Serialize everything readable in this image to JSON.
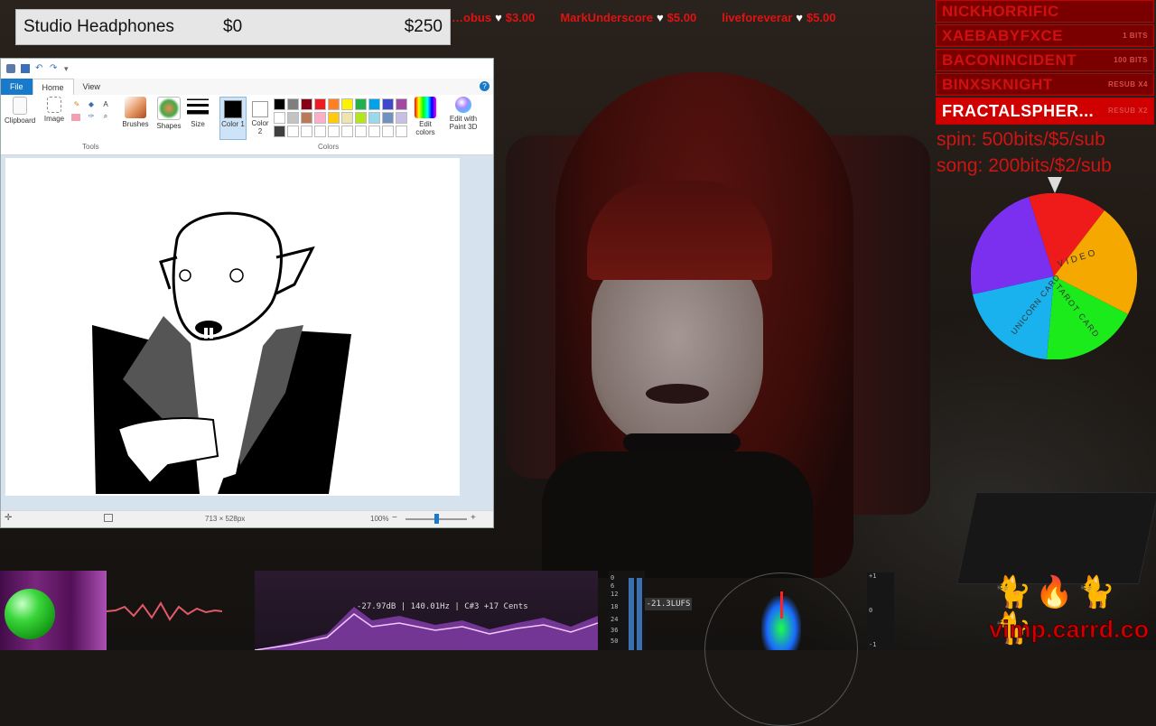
{
  "ticker": [
    {
      "name": "…obus",
      "amount": "$3.00"
    },
    {
      "name": "MarkUnderscore",
      "amount": "$5.00"
    },
    {
      "name": "liveforeverar",
      "amount": "$5.00"
    }
  ],
  "goal": {
    "name": "Studio Headphones",
    "start": "$0",
    "end": "$250",
    "progress": 0
  },
  "paint": {
    "tabs": {
      "file": "File",
      "home": "Home",
      "view": "View"
    },
    "help": "?",
    "ribbon": {
      "clipboard": "Clipboard",
      "image": "Image",
      "tools": "Tools",
      "brushes": "Brushes",
      "shapes": "Shapes",
      "size": "Size",
      "color1": "Color 1",
      "color2": "Color 2",
      "colors": "Colors",
      "edit_colors": "Edit colors",
      "edit_paint3d": "Edit with Paint 3D"
    },
    "palette": [
      "#000000",
      "#7f7f7f",
      "#880015",
      "#ed1c24",
      "#ff7f27",
      "#fff200",
      "#22b14c",
      "#00a2e8",
      "#3f48cc",
      "#a349a4",
      "#ffffff",
      "#c3c3c3",
      "#b97a57",
      "#ffaec9",
      "#ffc90e",
      "#efe4b0",
      "#b5e61d",
      "#99d9ea",
      "#7092be",
      "#c8bfe7",
      "#404040",
      "#ffffff",
      "#ffffff",
      "#ffffff",
      "#ffffff",
      "#ffffff",
      "#ffffff",
      "#ffffff",
      "#ffffff",
      "#ffffff"
    ],
    "status": {
      "dimensions": "713 × 528px",
      "zoom": "100%",
      "zoom_out": "−",
      "zoom_in": "+"
    }
  },
  "recent_events": [
    {
      "name": "NICKHORRIFIC",
      "tag": ""
    },
    {
      "name": "XAEBABYFXCE",
      "tag": "1 BITS"
    },
    {
      "name": "BACONINCIDENT",
      "tag": "100 BITS"
    },
    {
      "name": "BINXSKNIGHT",
      "tag": "RESUB X4"
    },
    {
      "name": "FRACTALSPHER...",
      "tag": "RESUB X2"
    }
  ],
  "info": {
    "spin": "spin: 500bits/$5/sub",
    "song": "song: 200bits/$2/sub"
  },
  "wheel": {
    "slices": [
      {
        "label": "",
        "color": "#ef1b1b"
      },
      {
        "label": "VIDEO",
        "color": "#f5a800"
      },
      {
        "label": "TAROT CARD",
        "color": "#1bea1b"
      },
      {
        "label": "UNICORN CARD",
        "color": "#19b2ef"
      },
      {
        "label": "",
        "color": "#7b2fef"
      }
    ]
  },
  "audio": {
    "readout": "-27.97dB | 140.01Hz | C#3 +17 Cents",
    "lufs": "-21.3LUFS",
    "meter_scale": [
      "0",
      "6",
      "12",
      "18",
      "24",
      "36",
      "50"
    ],
    "vector_scale": [
      "+1",
      "0",
      "-1"
    ]
  },
  "branding": {
    "url": "vimp.carrd.co"
  },
  "colors": {
    "accent_red": "#d00000",
    "paint_blue": "#1979ca"
  }
}
